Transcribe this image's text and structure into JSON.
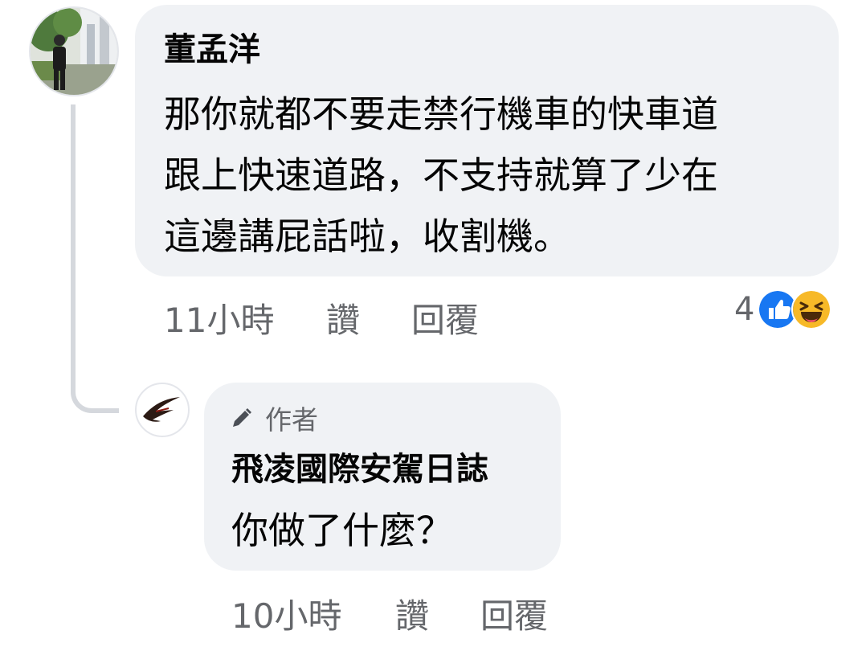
{
  "comment": {
    "author": "董孟洋",
    "lines": [
      "那你就都不要走禁行機車的快車道",
      "跟上快速道路，不支持就算了少在",
      "這邊講屁話啦，收割機。"
    ],
    "time": "11小時",
    "like_label": "讚",
    "reply_label": "回覆",
    "reaction_count": "4",
    "reactions": [
      "like-icon",
      "haha-icon"
    ]
  },
  "reply": {
    "badge_label": "作者",
    "author": "飛凌國際安駕日誌",
    "text": "你做了什麼？",
    "time": "10小時",
    "like_label": "讚",
    "reply_label": "回覆"
  },
  "colors": {
    "bubble_bg": "#f0f2f5",
    "meta_text": "#65676b",
    "like_blue": "#1877f2",
    "haha_yellow": "#f7b928",
    "thread_line": "#d5d8dd"
  }
}
